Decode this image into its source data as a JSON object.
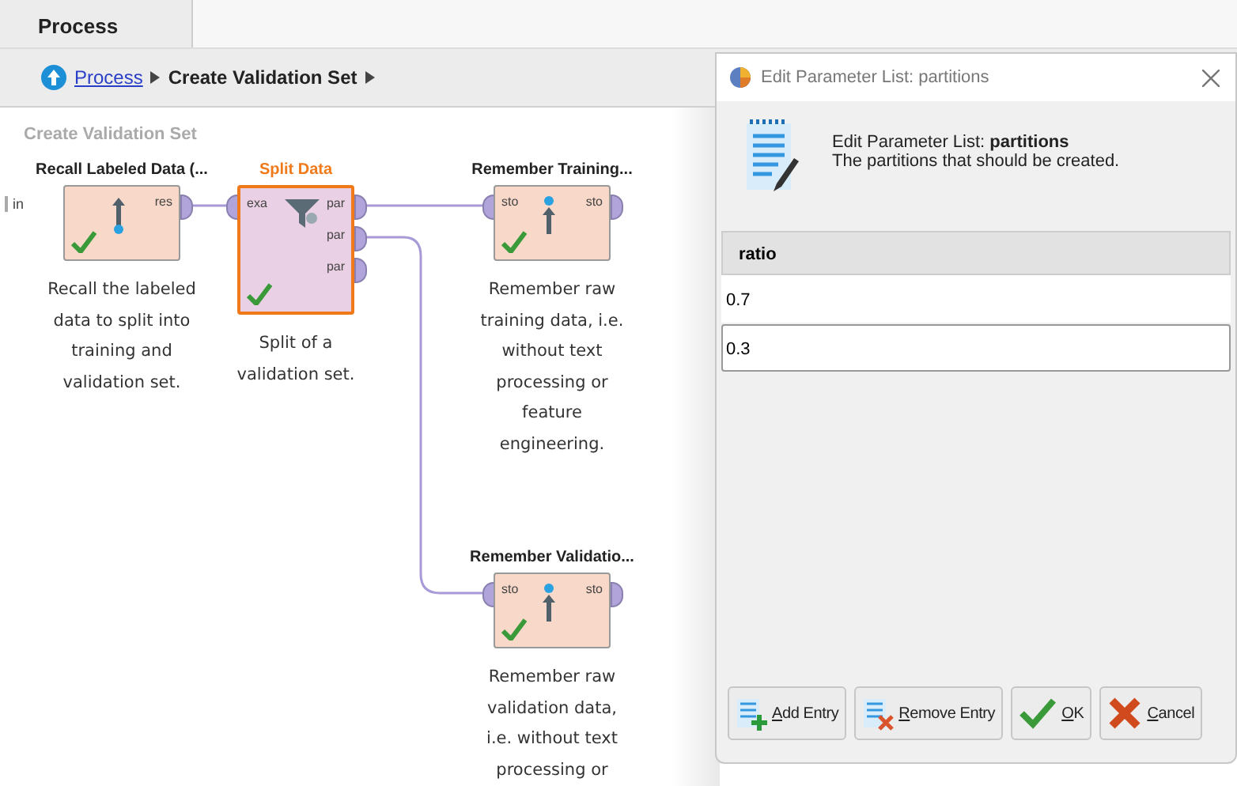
{
  "tabs": [
    {
      "label": "Process",
      "selected": true
    }
  ],
  "breadcrumb": [
    {
      "kind": "link",
      "label": "Process"
    },
    {
      "kind": "current",
      "label": "Create Validation Set"
    }
  ],
  "canvas": {
    "title": "Create Validation Set",
    "input_port": "in",
    "operators": [
      {
        "name": "Recall Labeled Data (...",
        "kind": "recall",
        "selected": false,
        "outputs": [
          "res"
        ],
        "description": "Recall the labeled data to split into training and validation set."
      },
      {
        "name": "Split Data",
        "kind": "filter",
        "selected": true,
        "inputs": [
          "exa"
        ],
        "outputs": [
          "par",
          "par",
          "par"
        ],
        "description": "Split of a validation set."
      },
      {
        "name": "Remember Training...",
        "kind": "remember",
        "selected": false,
        "inputs": [
          "sto"
        ],
        "outputs": [
          "sto"
        ],
        "description": "Remember raw training data, i.e. without text processing or feature engineering."
      },
      {
        "name": "Remember Validatio...",
        "kind": "remember",
        "selected": false,
        "inputs": [
          "sto"
        ],
        "outputs": [
          "sto"
        ],
        "description": "Remember raw validation data, i.e. without text processing or"
      }
    ]
  },
  "dialog": {
    "title": "Edit Parameter List: partitions",
    "heading": "Edit Parameter List: **partitions**",
    "description": "The partitions that should be created.",
    "table": {
      "columns": [
        "ratio"
      ],
      "rows": [
        {
          "value": "0.7",
          "editing": false
        },
        {
          "value": "0.3",
          "editing": true
        }
      ]
    },
    "buttons": [
      {
        "kind": "add",
        "label": "Add Entry"
      },
      {
        "kind": "remove",
        "label": "Remove Entry"
      },
      {
        "kind": "ok",
        "label": "OK"
      },
      {
        "kind": "cancel",
        "label": "Cancel"
      }
    ]
  }
}
